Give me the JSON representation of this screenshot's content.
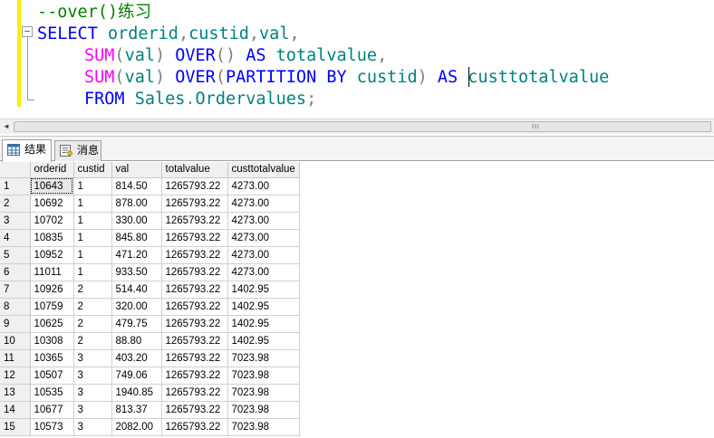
{
  "editor": {
    "lines": [
      [
        {
          "t": "--over()练习",
          "c": "c-comment"
        }
      ],
      [
        {
          "t": "SELECT ",
          "c": "c-kw"
        },
        {
          "t": "orderid",
          "c": "c-id"
        },
        {
          "t": ",",
          "c": "c-op"
        },
        {
          "t": "custid",
          "c": "c-id"
        },
        {
          "t": ",",
          "c": "c-op"
        },
        {
          "t": "val",
          "c": "c-id"
        },
        {
          "t": ",",
          "c": "c-op"
        }
      ],
      [
        {
          "t": "SUM",
          "c": "c-fn"
        },
        {
          "t": "(",
          "c": "c-op"
        },
        {
          "t": "val",
          "c": "c-id"
        },
        {
          "t": ") ",
          "c": "c-op"
        },
        {
          "t": "OVER",
          "c": "c-kw"
        },
        {
          "t": "() ",
          "c": "c-op"
        },
        {
          "t": "AS ",
          "c": "c-kw"
        },
        {
          "t": "totalvalue",
          "c": "c-id"
        },
        {
          "t": ",",
          "c": "c-op"
        }
      ],
      [
        {
          "t": "SUM",
          "c": "c-fn"
        },
        {
          "t": "(",
          "c": "c-op"
        },
        {
          "t": "val",
          "c": "c-id"
        },
        {
          "t": ") ",
          "c": "c-op"
        },
        {
          "t": "OVER",
          "c": "c-kw"
        },
        {
          "t": "(",
          "c": "c-op"
        },
        {
          "t": "PARTITION BY ",
          "c": "c-kw"
        },
        {
          "t": "custid",
          "c": "c-id"
        },
        {
          "t": ") ",
          "c": "c-op"
        },
        {
          "t": "AS ",
          "c": "c-kw"
        },
        {
          "t": "custtotalvalue",
          "c": "c-id"
        }
      ],
      [
        {
          "t": "FROM ",
          "c": "c-kw"
        },
        {
          "t": "Sales",
          "c": "c-id"
        },
        {
          "t": ".",
          "c": "c-op"
        },
        {
          "t": "Ordervalues",
          "c": "c-id"
        },
        {
          "t": ";",
          "c": "c-op"
        }
      ]
    ],
    "fold_symbol": "−"
  },
  "scrollbar": {
    "left_arrow": "◄",
    "grip": "III"
  },
  "tabs": [
    {
      "label": "结果",
      "icon": "grid-icon",
      "selected": true
    },
    {
      "label": "消息",
      "icon": "message-icon",
      "selected": false
    }
  ],
  "grid": {
    "columns": [
      "orderid",
      "custid",
      "val",
      "totalvalue",
      "custtotalvalue"
    ],
    "rows": [
      [
        "1",
        "10643",
        "1",
        "814.50",
        "1265793.22",
        "4273.00"
      ],
      [
        "2",
        "10692",
        "1",
        "878.00",
        "1265793.22",
        "4273.00"
      ],
      [
        "3",
        "10702",
        "1",
        "330.00",
        "1265793.22",
        "4273.00"
      ],
      [
        "4",
        "10835",
        "1",
        "845.80",
        "1265793.22",
        "4273.00"
      ],
      [
        "5",
        "10952",
        "1",
        "471.20",
        "1265793.22",
        "4273.00"
      ],
      [
        "6",
        "11011",
        "1",
        "933.50",
        "1265793.22",
        "4273.00"
      ],
      [
        "7",
        "10926",
        "2",
        "514.40",
        "1265793.22",
        "1402.95"
      ],
      [
        "8",
        "10759",
        "2",
        "320.00",
        "1265793.22",
        "1402.95"
      ],
      [
        "9",
        "10625",
        "2",
        "479.75",
        "1265793.22",
        "1402.95"
      ],
      [
        "10",
        "10308",
        "2",
        "88.80",
        "1265793.22",
        "1402.95"
      ],
      [
        "11",
        "10365",
        "3",
        "403.20",
        "1265793.22",
        "7023.98"
      ],
      [
        "12",
        "10507",
        "3",
        "749.06",
        "1265793.22",
        "7023.98"
      ],
      [
        "13",
        "10535",
        "3",
        "1940.85",
        "1265793.22",
        "7023.98"
      ],
      [
        "14",
        "10677",
        "3",
        "813.37",
        "1265793.22",
        "7023.98"
      ],
      [
        "15",
        "10573",
        "3",
        "2082.00",
        "1265793.22",
        "7023.98"
      ]
    ]
  }
}
